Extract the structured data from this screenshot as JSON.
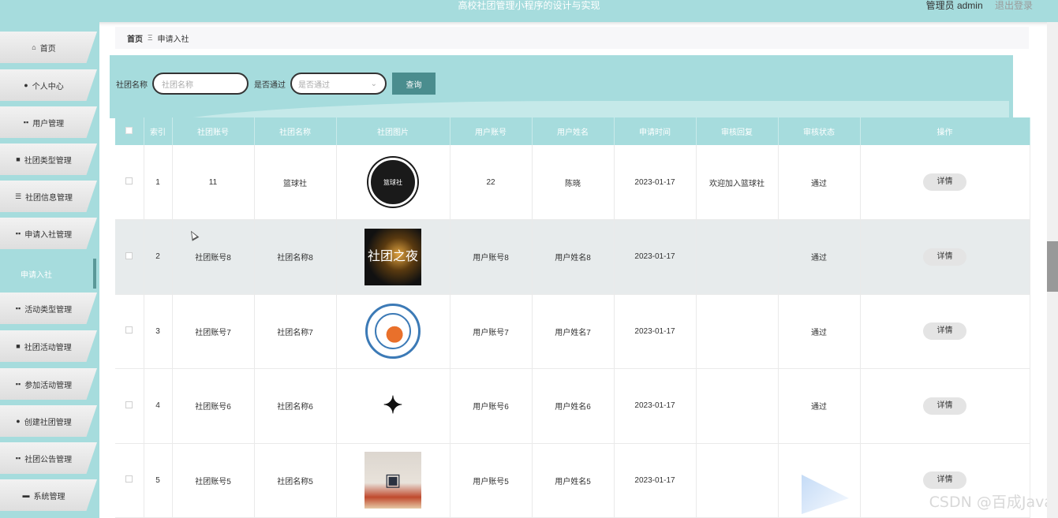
{
  "app": {
    "title": "高校社团管理小程序的设计与实现",
    "user_role": "管理员 admin",
    "logout_label": "退出登录"
  },
  "sidebar": {
    "items": [
      {
        "label": "首页",
        "icon": "home-icon",
        "glyph": "⌂",
        "active": false
      },
      {
        "label": "个人中心",
        "icon": "person-icon",
        "glyph": "●",
        "active": false
      },
      {
        "label": "用户管理",
        "icon": "grid-icon",
        "glyph": "▪▪",
        "active": false
      },
      {
        "label": "社团类型管理",
        "icon": "briefcase-icon",
        "glyph": "■",
        "active": false
      },
      {
        "label": "社团信息管理",
        "icon": "list-icon",
        "glyph": "☰",
        "active": false
      },
      {
        "label": "申请入社管理",
        "icon": "grid-icon",
        "glyph": "▪▪",
        "active": false
      },
      {
        "label": "申请入社",
        "icon": "",
        "glyph": "",
        "active": true
      },
      {
        "label": "活动类型管理",
        "icon": "grid-icon",
        "glyph": "▪▪",
        "active": false
      },
      {
        "label": "社团活动管理",
        "icon": "briefcase-icon",
        "glyph": "■",
        "active": false
      },
      {
        "label": "参加活动管理",
        "icon": "grid-icon",
        "glyph": "▪▪",
        "active": false
      },
      {
        "label": "创建社团管理",
        "icon": "pin-icon",
        "glyph": "●",
        "active": false
      },
      {
        "label": "社团公告管理",
        "icon": "grid-icon",
        "glyph": "▪▪",
        "active": false
      },
      {
        "label": "系统管理",
        "icon": "monitor-icon",
        "glyph": "▬",
        "active": false
      }
    ]
  },
  "breadcrumb": {
    "home": "首页",
    "separator": "Ξ",
    "current": "申请入社"
  },
  "search": {
    "club_name_label": "社团名称",
    "club_name_placeholder": "社团名称",
    "approved_label": "是否通过",
    "approved_placeholder": "是否通过",
    "query_button": "查询"
  },
  "table": {
    "headers": [
      "索引",
      "社团账号",
      "社团名称",
      "社团图片",
      "用户账号",
      "用户姓名",
      "申请时间",
      "审核回复",
      "审核状态",
      "操作"
    ],
    "rows": [
      {
        "index": "1",
        "club_account": "11",
        "club_name": "篮球社",
        "image": "basketball-club-logo",
        "image_text": "篮球社",
        "user_account": "22",
        "user_name": "陈晓",
        "apply_time": "2023-01-17",
        "reply": "欢迎加入篮球社",
        "status": "通过",
        "action": "详情"
      },
      {
        "index": "2",
        "club_account": "社团账号8",
        "club_name": "社团名称8",
        "image": "club-night-poster",
        "image_text": "社团之夜",
        "user_account": "用户账号8",
        "user_name": "用户姓名8",
        "apply_time": "2023-01-17",
        "reply": "",
        "status": "通过",
        "action": "详情"
      },
      {
        "index": "3",
        "club_account": "社团账号7",
        "club_name": "社团名称7",
        "image": "football-club-logo",
        "image_text": "",
        "user_account": "用户账号7",
        "user_name": "用户姓名7",
        "apply_time": "2023-01-17",
        "reply": "",
        "status": "通过",
        "action": "详情"
      },
      {
        "index": "4",
        "club_account": "社团账号6",
        "club_name": "社团名称6",
        "image": "calligraphy-club-logo",
        "image_text": "",
        "user_account": "用户账号6",
        "user_name": "用户姓名6",
        "apply_time": "2023-01-17",
        "reply": "",
        "status": "通过",
        "action": "详情"
      },
      {
        "index": "5",
        "club_account": "社团账号5",
        "club_name": "社团名称5",
        "image": "room-photo",
        "image_text": "",
        "user_account": "用户账号5",
        "user_name": "用户姓名5",
        "apply_time": "2023-01-17",
        "reply": "",
        "status": "",
        "action": "详情"
      }
    ]
  },
  "watermark": "CSDN @百成Java",
  "colors": {
    "accent": "#a6dcdd",
    "button_dark": "#4a8d8e"
  }
}
